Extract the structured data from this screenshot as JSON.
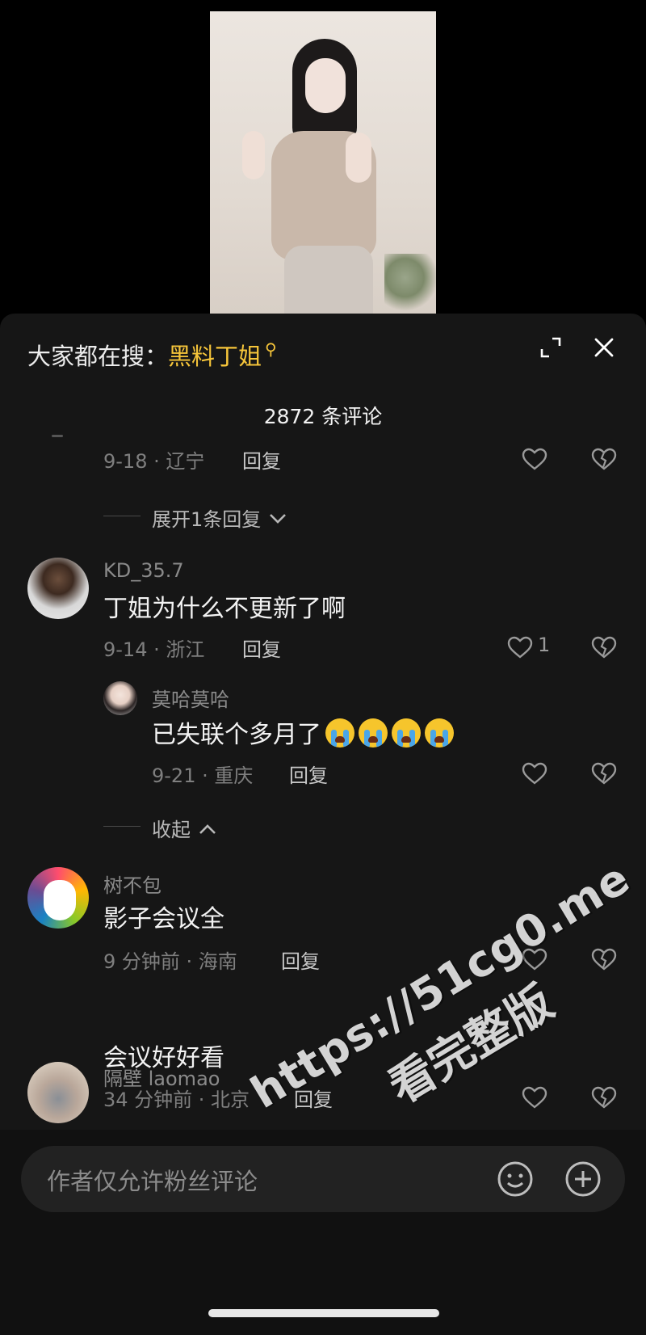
{
  "search": {
    "prefix": "大家都在搜：",
    "keyword": "黑料丁姐"
  },
  "comments_count": "2872 条评论",
  "items": [
    {
      "meta": "9-18 · 辽宁",
      "reply": "回复"
    },
    {
      "expand": "展开1条回复"
    },
    {
      "user": "KD_35.7",
      "text": "丁姐为什么不更新了啊",
      "meta": "9-14 · 浙江",
      "reply": "回复",
      "likes": "1"
    },
    {
      "user": "莫哈莫哈",
      "text": "已失联个多月了",
      "meta": "9-21 · 重庆",
      "reply": "回复"
    },
    {
      "collapse": "收起"
    },
    {
      "user": "树不包",
      "text": "影子会议全",
      "meta": "9 分钟前 · 海南",
      "reply": "回复"
    },
    {
      "user": "隔壁 laomao",
      "text": "会议好好看",
      "meta": "34 分钟前 · 北京",
      "reply": "回复"
    }
  ],
  "input": {
    "placeholder": "作者仅允许粉丝评论"
  },
  "watermark": {
    "line1": "https://51cg0.me",
    "line2": "看完整版"
  },
  "icons": [
    "expand-icon",
    "close-icon",
    "heart-icon",
    "broken-heart-icon",
    "emoji-icon",
    "plus-icon",
    "chevron-down-icon",
    "chevron-up-icon"
  ],
  "colors": {
    "keyword": "#f6c53a",
    "sheet": "#161616",
    "muted": "#7f7f7f"
  }
}
